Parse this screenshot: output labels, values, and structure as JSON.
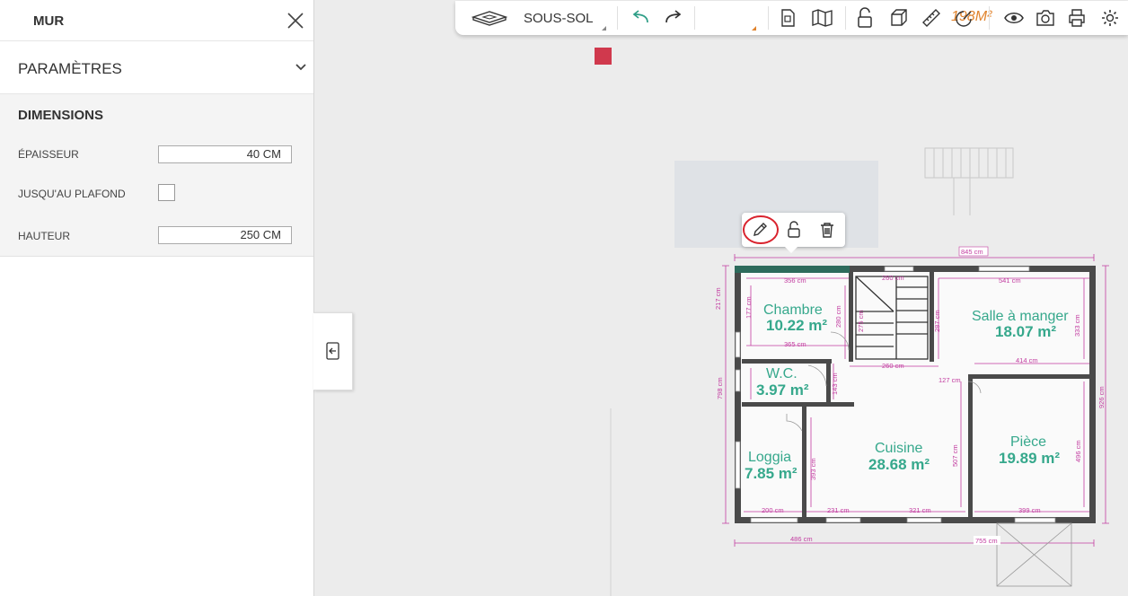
{
  "panel": {
    "title": "MUR",
    "section_label": "PARAMÈTRES",
    "dimensions_title": "DIMENSIONS",
    "fields": {
      "thickness": {
        "label": "ÉPAISSEUR",
        "value": "40  CM"
      },
      "to_ceiling": {
        "label": "JUSQU'AU PLAFOND",
        "checked": false
      },
      "height": {
        "label": "HAUTEUR",
        "value": "250  CM"
      }
    }
  },
  "toolbar": {
    "level": "SOUS-SOL",
    "surface": "198M²"
  },
  "floorplan": {
    "rooms": [
      {
        "name": "Chambre",
        "area": "10.22 m²"
      },
      {
        "name": "Salle à manger",
        "area": "18.07 m²"
      },
      {
        "name": "W.C.",
        "area": "3.97 m²"
      },
      {
        "name": "Cuisine",
        "area": "28.68 m²"
      },
      {
        "name": "Pièce",
        "area": "19.89 m²"
      },
      {
        "name": "Loggia",
        "area": "7.85 m²"
      }
    ],
    "dims": {
      "d845": "845 cm",
      "d356": "356 cm",
      "d365": "365 cm",
      "d260": "260 cm",
      "d541": "541 cm",
      "d414": "414 cm",
      "d127": "127 cm",
      "d143": "143 cm",
      "d217": "217 cm",
      "d177": "177 cm",
      "d280": "280 cm",
      "d287": "287 cm",
      "d333": "333 cm",
      "d798": "798 cm",
      "d926": "926 cm",
      "d393": "393 cm",
      "d507": "507 cm",
      "d496": "496 cm",
      "d200": "200 cm",
      "d231": "231 cm",
      "d321": "321 cm",
      "d399": "399 cm",
      "d486": "486 cm",
      "d755": "755 cm",
      "d275": "275 cm"
    },
    "colors": {
      "room_label": "#36a88c",
      "dimension": "#c23ca0",
      "wall": "#4a4a4a",
      "selected_wall": "#2e6b5c"
    }
  },
  "colors": {
    "accent_orange": "#e0832d",
    "marker_red": "#d0394d",
    "highlight_circle": "#d9232e"
  }
}
